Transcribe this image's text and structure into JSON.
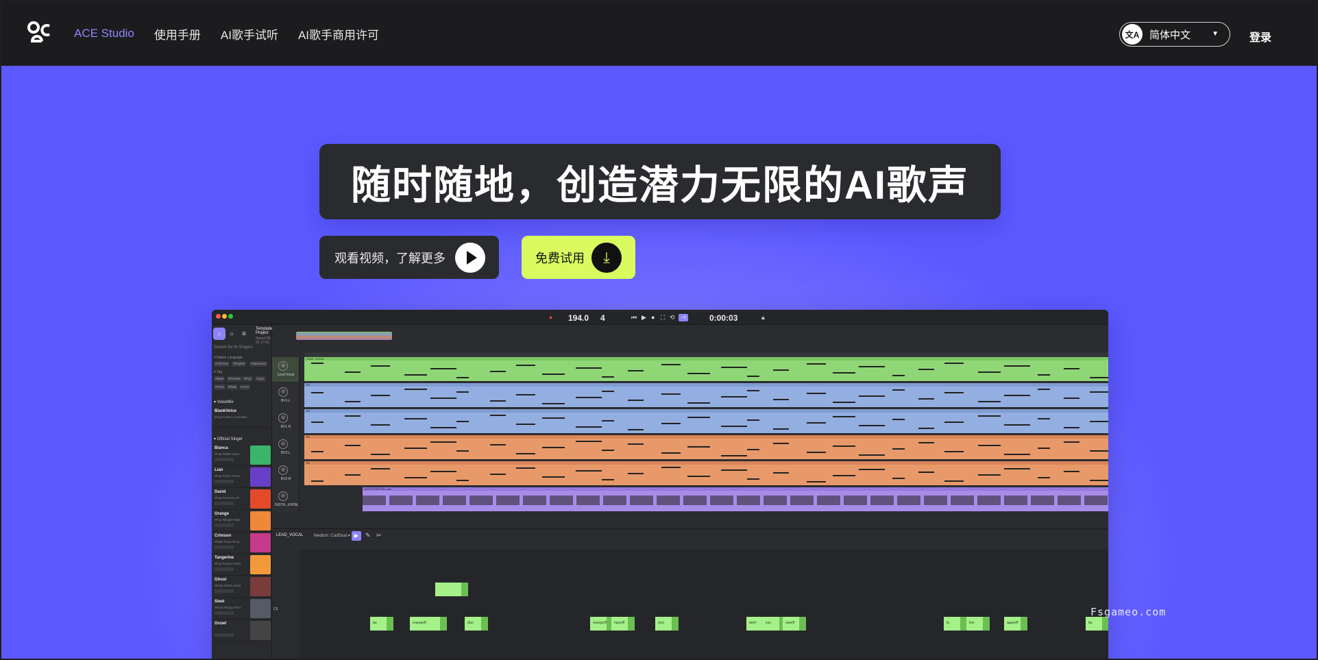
{
  "nav": {
    "brand": "ACE Studio",
    "links": [
      "使用手册",
      "AI歌手试听",
      "AI歌手商用许可"
    ],
    "language": "简体中文",
    "language_icon": "文A",
    "login": "登录"
  },
  "hero": {
    "title": "随时随地，创造潜力无限的AI歌声",
    "video_button": "观看视频，了解更多",
    "try_button": "免费试用"
  },
  "app": {
    "tempo": "194.0",
    "beats": "4",
    "time": "0:00:03",
    "project_title": "Template Project",
    "project_saved": "Saved 08-22 17:03",
    "search_placeholder": "Search for AI Singers",
    "native_language_label": "# Native Language",
    "language_chips": [
      "#Chinese",
      "#English",
      "#Japanese"
    ],
    "tag_label": "# Tag",
    "tag_chips": [
      "#Male",
      "#Female",
      "#Pop",
      "#Jazz",
      "#Rock",
      "#R&B",
      "#ACG"
    ],
    "voicemix_header": "▾ VoiceMix",
    "blank_voice": {
      "name": "BlankVoice",
      "desc": "Drag to start a VoiceMix"
    },
    "official_header": "▾ Official Singer",
    "singers": [
      {
        "name": "Bianca",
        "tags": "#Pop #R&B #Jazz",
        "color": "#3bb56a"
      },
      {
        "name": "Lian",
        "tags": "#Pop #ACG #Soul",
        "color": "#6a3fc7"
      },
      {
        "name": "David",
        "tags": "#Pop #Country #F",
        "color": "#e24a2a"
      },
      {
        "name": "Orange",
        "tags": "#Pop #Bright #Idol",
        "color": "#f0883a"
      },
      {
        "name": "Crimson",
        "tags": "#R&B #Soul #Pop",
        "color": "#c43b8a"
      },
      {
        "name": "Tangerine",
        "tags": "#Pop #Cpop #Clea",
        "color": "#f29a3a"
      },
      {
        "name": "Ghost",
        "tags": "#Rock #Dark #Gritt",
        "color": "#7a3b3b"
      },
      {
        "name": "Steel",
        "tags": "#Rock #Epop #Grit",
        "color": "#555a66"
      },
      {
        "name": "Growl",
        "tags": "",
        "color": "#444"
      }
    ],
    "tracks": [
      {
        "name": "Lead Vocal",
        "label": "LEAD_VOCAL",
        "color": "#8fd676",
        "head": "#7cc763"
      },
      {
        "name": "BV1-L",
        "label": "BV",
        "color": "#93aee0",
        "head": "#809cd2"
      },
      {
        "name": "BV1-R",
        "label": "BV",
        "color": "#93aee0",
        "head": "#809cd2"
      },
      {
        "name": "BV2-L",
        "label": "BV",
        "color": "#e8996a",
        "head": "#d9875a"
      },
      {
        "name": "BV2-R",
        "label": "BV",
        "color": "#e8996a",
        "head": "#d9875a"
      },
      {
        "name": "INSTR...ENTAL",
        "label": "INSTRUMENTAL.wav",
        "color": "#a88cea",
        "head": "#9678de"
      }
    ],
    "editor_track": "LEAD_VOCAL",
    "editor_mode": "Medium: CadDual ▾",
    "c5_label": "C5",
    "note_labels": [
      "ba",
      "orange(ff",
      "(bo)",
      "orange(ff",
      "have(ff",
      "(no)",
      "don't",
      "you",
      "own(ff",
      "fu",
      "live",
      "again(ff",
      "ba"
    ]
  },
  "watermark": "Fsgameo.com",
  "colors": {
    "accent": "#8f86ff",
    "hero_bg": "#5b59ff",
    "cta_green": "#d9fb5f",
    "dark": "#2a2b2e"
  }
}
